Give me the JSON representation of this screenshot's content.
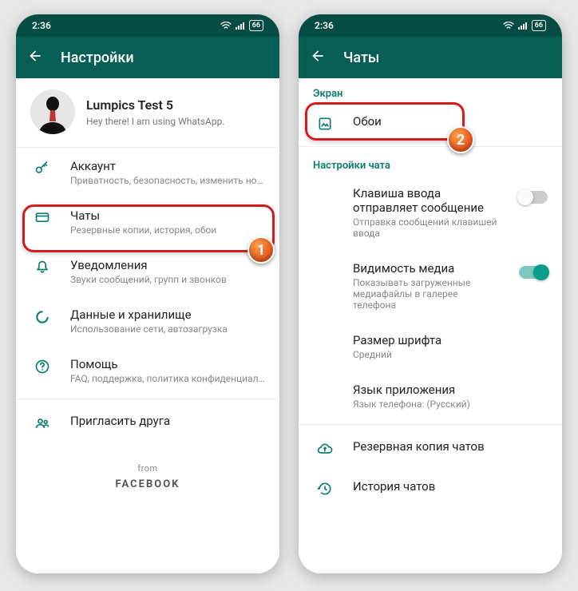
{
  "status": {
    "time": "2:36",
    "battery": "66"
  },
  "left": {
    "appbar_title": "Настройки",
    "profile": {
      "name": "Lumpics Test 5",
      "status": "Hey there! I am using WhatsApp."
    },
    "items": [
      {
        "title": "Аккаунт",
        "sub": "Приватность, безопасность, изменить номер"
      },
      {
        "title": "Чаты",
        "sub": "Резервные копии, история, обои"
      },
      {
        "title": "Уведомления",
        "sub": "Звуки сообщений, групп и звонков"
      },
      {
        "title": "Данные и хранилище",
        "sub": "Использование сети, автозагрузка"
      },
      {
        "title": "Помощь",
        "sub": "FAQ, поддержка, политика конфиденциальн..."
      },
      {
        "title": "Пригласить друга",
        "sub": ""
      }
    ],
    "footer_from": "from",
    "footer_brand": "FACEBOOK"
  },
  "right": {
    "appbar_title": "Чаты",
    "sections": {
      "screen_header": "Экран",
      "wallpaper": "Обои",
      "chat_settings_header": "Настройки чата",
      "enter_send_title": "Клавиша ввода отправляет сообщение",
      "enter_send_sub": "Отправка сообщений клавишей ввода",
      "media_vis_title": "Видимость медиа",
      "media_vis_sub": "Показывать загруженные медиафайлы в галерее телефона",
      "font_title": "Размер шрифта",
      "font_sub": "Средний",
      "lang_title": "Язык приложения",
      "lang_sub": "Язык телефона: (Русский)",
      "backup": "Резервная копия чатов",
      "history": "История чатов"
    }
  },
  "callouts": {
    "one": "1",
    "two": "2"
  }
}
